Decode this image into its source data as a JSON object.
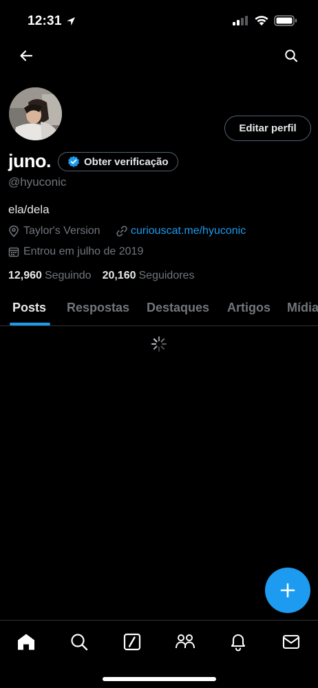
{
  "status_bar": {
    "time": "12:31"
  },
  "header": {
    "back_icon": "arrow-left-icon",
    "search_icon": "search-icon"
  },
  "profile": {
    "display_name": "juno.",
    "verify_label": "Obter verificação",
    "edit_label": "Editar perfil",
    "handle": "@hyuconic",
    "bio": "ela/dela",
    "location": "Taylor's Version",
    "link": "curiouscat.me/hyuconic",
    "joined": "Entrou em julho de 2019",
    "following_count": "12,960",
    "following_label": "Seguindo",
    "followers_count": "20,160",
    "followers_label": "Seguidores"
  },
  "tabs": [
    {
      "label": "Posts",
      "active": true
    },
    {
      "label": "Respostas",
      "active": false
    },
    {
      "label": "Destaques",
      "active": false
    },
    {
      "label": "Artigos",
      "active": false
    },
    {
      "label": "Mídia",
      "active": false
    }
  ],
  "bottom_nav": [
    "home-icon",
    "search-icon",
    "grok-icon",
    "communities-icon",
    "notifications-icon",
    "messages-icon"
  ],
  "colors": {
    "accent": "#1d9bf0",
    "background": "#000000",
    "muted": "#71767b",
    "text": "#e7e9ea"
  }
}
